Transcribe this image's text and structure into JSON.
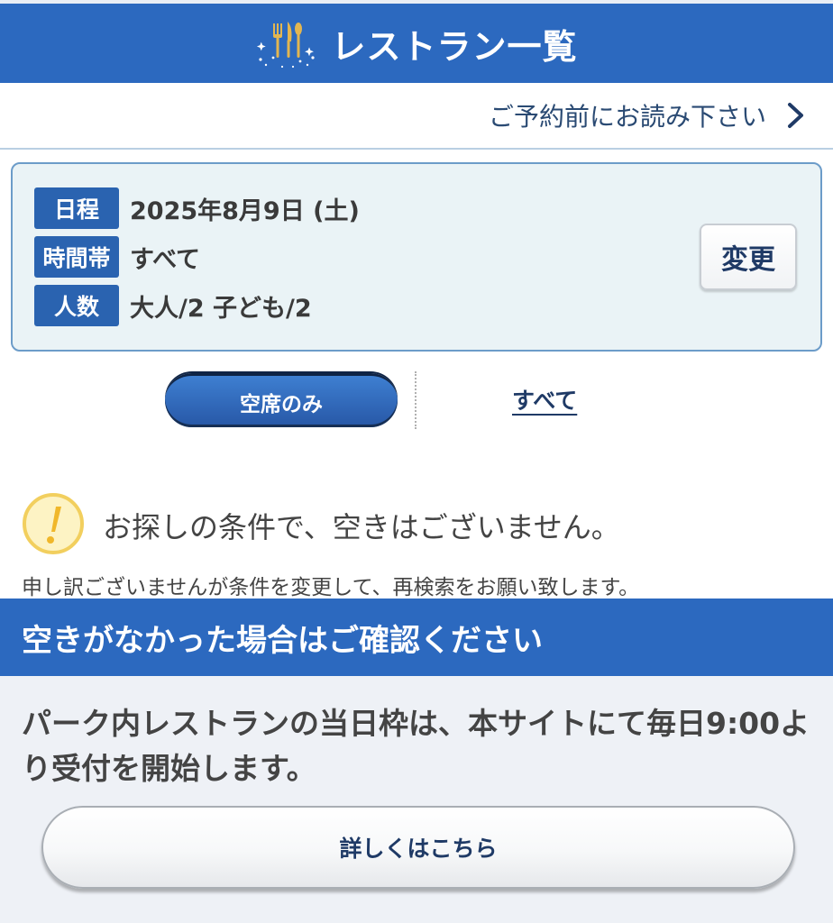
{
  "header": {
    "title": "レストラン一覧",
    "icon": "cutlery-icon"
  },
  "notice": {
    "label": "ご予約前にお読み下さい"
  },
  "conditions": {
    "rows": [
      {
        "label": "日程",
        "value": "2025年8月9日 (土)"
      },
      {
        "label": "時間帯",
        "value": "すべて"
      },
      {
        "label": "人数",
        "value": "大人/2 子ども/2"
      }
    ],
    "change_label": "変更"
  },
  "filter": {
    "available_only": "空席のみ",
    "all": "すべて",
    "selected": "空席のみ"
  },
  "message": {
    "title": "お探しの条件で、空きはございません。",
    "subtitle": "申し訳ございませんが条件を変更して、再検索をお願い致します。"
  },
  "section": {
    "banner": "空きがなかった場合はご確認ください",
    "text": "パーク内レストランの当日枠は、本サイトにて毎日9:00より受付を開始します。",
    "details_label": "詳しくはこちら"
  },
  "colors": {
    "primary_blue": "#2c69bf",
    "label_blue": "#2a63b0",
    "box_bg": "#eaf3f6",
    "warning_yellow": "#f5d76e"
  }
}
